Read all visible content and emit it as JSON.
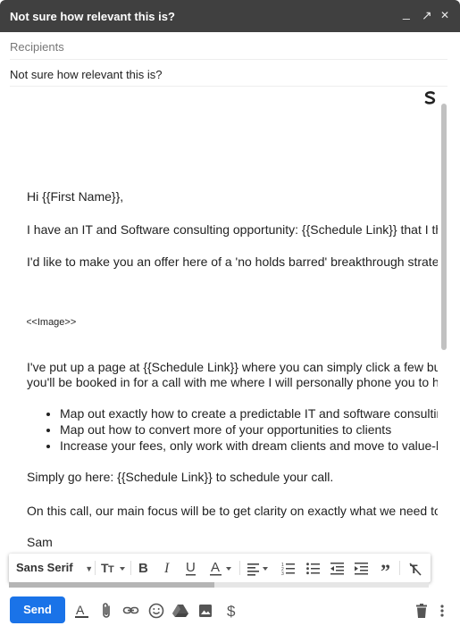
{
  "window": {
    "title": "Not sure how relevant this is?",
    "minimize_glyph": "_",
    "popout_glyph": "↗",
    "close_glyph": "✕"
  },
  "header": {
    "recipients_placeholder": "Recipients",
    "subject": "Not sure how relevant this is?"
  },
  "body": {
    "greeting": "Hi {{First Name}},",
    "para1": "I have an IT and Software consulting opportunity: {{Schedule Link}} that I think you'd be interested in.",
    "para2": "I'd like to make you an offer here of a 'no holds barred' breakthrough strategy session.",
    "image_placeholder": "<<Image>>",
    "para3_line1": "I've put up a page at {{Schedule Link}} where you can simply click a few buttons and",
    "para3_line2": "you'll be booked in for a call with me where I will personally phone you to help you:",
    "bullets": [
      "Map out exactly how to create a predictable IT and software consulting pipeline",
      "Map out how to convert more of your opportunities to clients",
      "Increase your fees, only work with dream clients and move to value-based pricing"
    ],
    "para4": "Simply go here: {{Schedule Link}} to schedule your call.",
    "para5": "On this call, our main focus will be to get clarity on exactly what we need to do.",
    "signature": "Sam"
  },
  "format_toolbar": {
    "font_family": "Sans Serif",
    "font_size_icon": "text-size-icon",
    "bold_icon": "bold-icon",
    "italic_icon": "italic-icon",
    "underline_icon": "underline-icon",
    "text_color_icon": "text-color-icon",
    "align_icon": "align-icon",
    "numbered_list_icon": "numbered-list-icon",
    "bulleted_list_icon": "bulleted-list-icon",
    "indent_less_icon": "indent-less-icon",
    "indent_more_icon": "indent-more-icon",
    "quote_icon": "quote-icon",
    "remove_formatting_icon": "remove-formatting-icon"
  },
  "bottom_toolbar": {
    "send_label": "Send",
    "icons": [
      "formatting-options-icon",
      "attach-icon",
      "link-icon",
      "emoji-icon",
      "drive-icon",
      "photo-icon",
      "money-icon",
      "trash-icon",
      "more-options-icon"
    ]
  },
  "colors": {
    "titlebar_bg": "#404040",
    "send_button": "#1a73e8",
    "text": "#222222"
  }
}
